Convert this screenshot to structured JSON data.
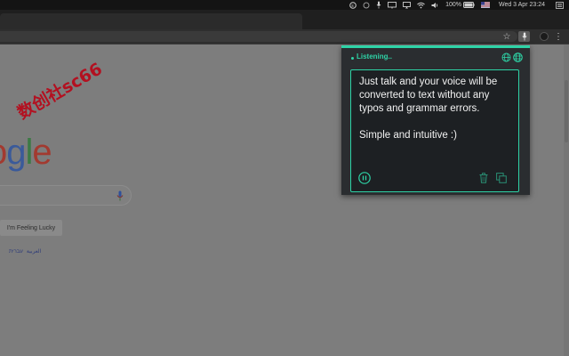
{
  "menubar": {
    "icons": [
      "skype-icon",
      "circle-icon",
      "mic-icon",
      "display-icon",
      "cast-icon",
      "wifi-icon",
      "volume-icon",
      "battery-icon",
      "flag-icon",
      "menu-list-icon"
    ],
    "battery": "100%",
    "datetime": "Wed 3 Apr  23:24"
  },
  "toolbar": {
    "icons": [
      "star-icon",
      "mic-icon",
      "profile-icon",
      "menu-dots-icon"
    ]
  },
  "page": {
    "logo_fragment": [
      "o",
      "g",
      "l",
      "e"
    ],
    "lucky_button": "I'm Feeling Lucky",
    "languages": [
      "العربية",
      "עברית"
    ],
    "watermark": "数创社sc66"
  },
  "popup": {
    "status": "Listening..",
    "transcript_p1": "Just talk and your voice will be converted to text without any typos and grammar errors.",
    "transcript_p2": "Simple and intuitive :)",
    "accent_color": "#2ed3a6",
    "icons": [
      "globe-icon",
      "globe-icon",
      "pause-icon",
      "trash-icon",
      "copy-icon"
    ]
  }
}
